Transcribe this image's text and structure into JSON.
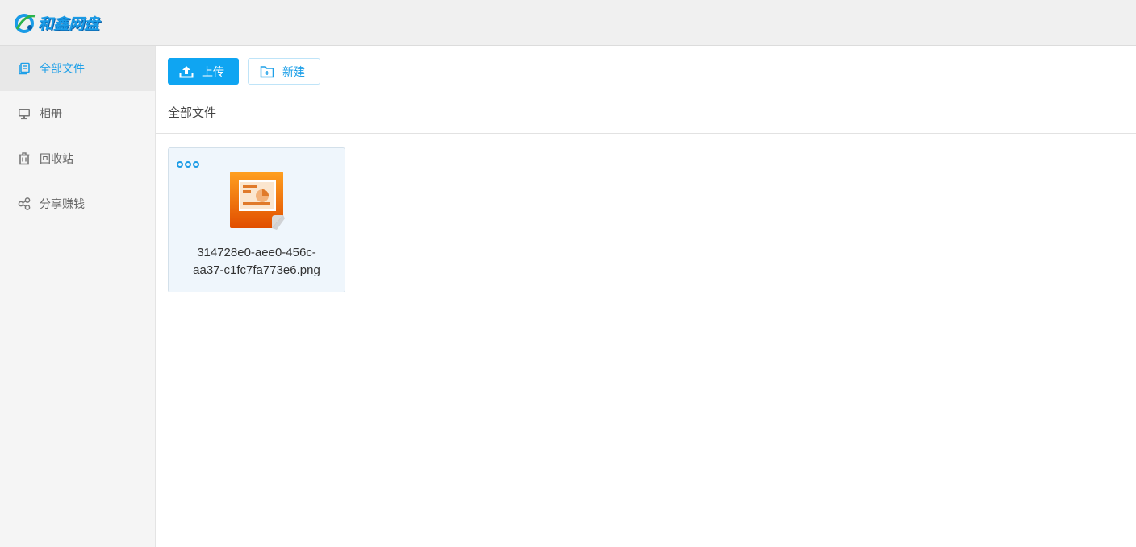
{
  "app": {
    "logo_text": "和鑫网盘",
    "brand_color": "#1a9be6",
    "accent_color": "#0fa5f2"
  },
  "sidebar": {
    "items": [
      {
        "label": "全部文件",
        "icon": "files-icon",
        "active": true
      },
      {
        "label": "相册",
        "icon": "monitor-icon",
        "active": false
      },
      {
        "label": "回收站",
        "icon": "trash-icon",
        "active": false
      },
      {
        "label": "分享赚钱",
        "icon": "share-icon",
        "active": false
      }
    ]
  },
  "toolbar": {
    "upload_label": "上传",
    "upload_icon": "upload-icon",
    "new_label": "新建",
    "new_icon": "new-folder-icon"
  },
  "breadcrumb": {
    "current": "全部文件"
  },
  "files": [
    {
      "name_line1": "314728e0-aee0-456c-",
      "name_line2": "aa37-c1fc7fa773e6.png",
      "icon": "presentation-file-icon",
      "menu_icon": "more-options-icon"
    }
  ]
}
